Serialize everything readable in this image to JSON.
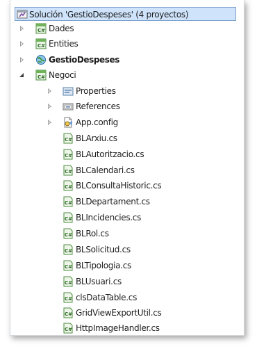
{
  "explorer": {
    "solution_label": "Solución 'GestioDespeses'  (4 proyectos)",
    "projects": [
      {
        "label": "Dades",
        "state": "collapsed",
        "icon": "csharp-project-icon"
      },
      {
        "label": "Entities",
        "state": "collapsed",
        "icon": "csharp-project-icon"
      },
      {
        "label": "GestioDespeses",
        "state": "collapsed",
        "icon": "web-project-icon",
        "bold": true
      },
      {
        "label": "Negoci",
        "state": "expanded",
        "icon": "csharp-project-icon"
      }
    ],
    "negoci_folders": [
      {
        "label": "Properties",
        "icon": "properties-icon"
      },
      {
        "label": "References",
        "icon": "references-icon"
      },
      {
        "label": "App.config",
        "icon": "config-file-icon"
      }
    ],
    "negoci_files": [
      "BLArxiu.cs",
      "BLAutoritzacio.cs",
      "BLCalendari.cs",
      "BLConsultaHistoric.cs",
      "BLDepartament.cs",
      "BLIncidencies.cs",
      "BLRol.cs",
      "BLSolicitud.cs",
      "BLTipologia.cs",
      "BLUsuari.cs",
      "clsDataTable.cs",
      "GridViewExportUtil.cs",
      "HttpImageHandler.cs"
    ]
  }
}
